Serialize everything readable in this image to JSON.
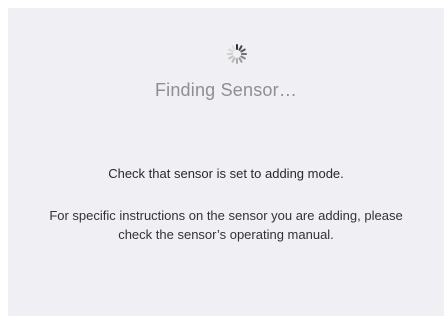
{
  "status": {
    "title": "Finding Sensor…",
    "spinner_icon": "activity-spinner",
    "title_color": "#8e8e93"
  },
  "instructions": {
    "primary": "Check that sensor is set to adding mode.",
    "secondary": "For specific instructions on the sensor you are adding, please check the sensor’s operating manual."
  },
  "colors": {
    "background": "#efeff4",
    "text": "#2a2a2a"
  }
}
